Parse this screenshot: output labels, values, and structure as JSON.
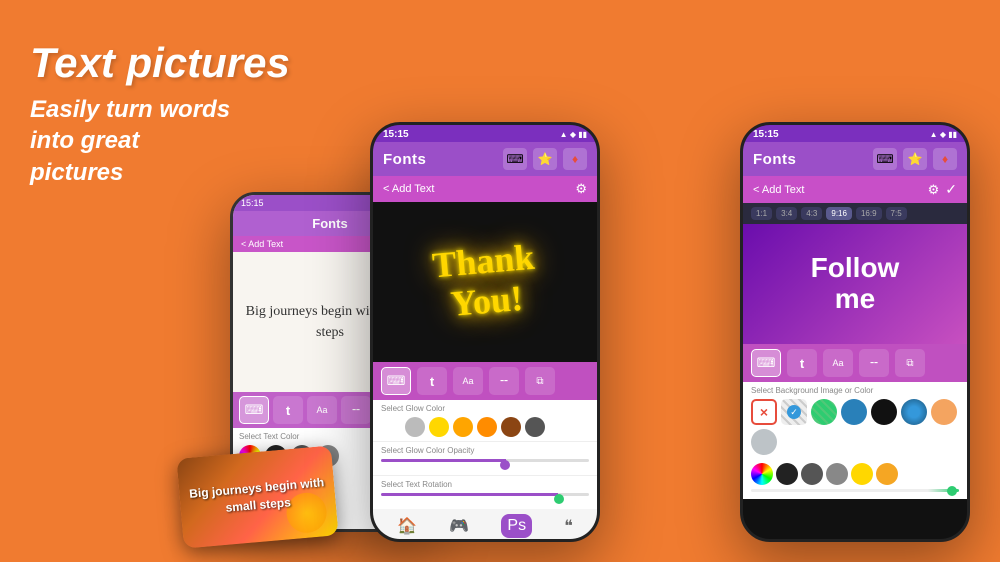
{
  "background": "#F07B30",
  "hero": {
    "title": "Text pictures",
    "subtitle_line1": "Easily turn words",
    "subtitle_line2": "into great",
    "subtitle_line3": "pictures"
  },
  "phone_left_small": {
    "time": "15:15",
    "fonts_label": "Fonts",
    "add_text_label": "< Add Text",
    "canvas_text": "Big journeys begin with small steps"
  },
  "card_overlay": {
    "text": "Big journeys begin with small steps"
  },
  "phone_mid": {
    "time": "15:15",
    "fonts_label": "Fonts",
    "add_text_label": "< Add Text",
    "canvas_text_line1": "Thank",
    "canvas_text_line2": "You!",
    "glow_color_label": "Select Glow Color",
    "glow_opacity_label": "Select Glow Color Opacity",
    "rotation_label": "Select Text Rotation"
  },
  "phone_right": {
    "time": "15:15",
    "fonts_label": "Fonts",
    "add_text_label": "< Add Text",
    "canvas_text_line1": "Follow",
    "canvas_text_line2": "me",
    "bg_select_label": "Select Background Image or Color",
    "ratio_options": [
      "1:1",
      "3:4",
      "4:3",
      "9:16",
      "16:9",
      "7:5"
    ]
  },
  "toolbar_icons": {
    "keyboard": "⌨",
    "font_t": "𝐭",
    "font_aa": "Aa",
    "underline": "_",
    "copy": "⧉"
  },
  "colors": {
    "glow": [
      "rainbow",
      "#ccc",
      "#FFD700",
      "#FFA500",
      "#FF8C00",
      "#8B4513",
      "#666"
    ],
    "bg_right": [
      "x",
      "check_striped",
      "diamond_green",
      "blue_dark",
      "blue_med",
      "dotted_blue",
      "light_blue",
      "gray"
    ]
  }
}
